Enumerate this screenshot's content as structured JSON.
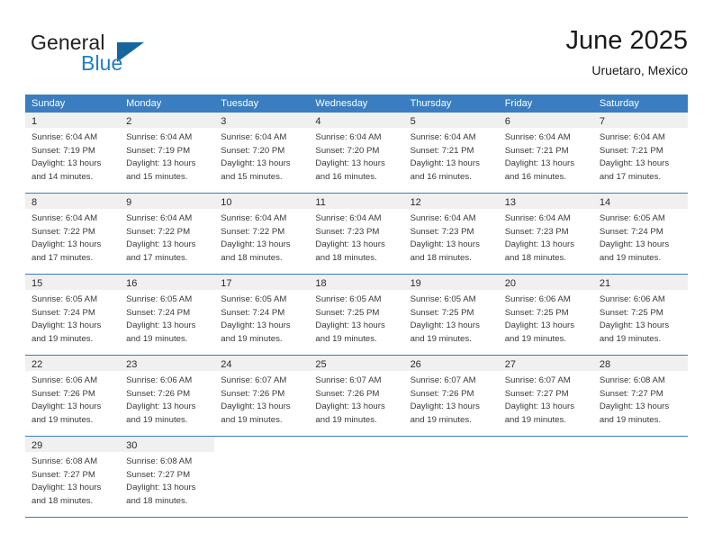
{
  "brand": {
    "line1": "General",
    "line2": "Blue",
    "triangle_icon": "brand-triangle-icon",
    "color_dark": "#231f20",
    "color_blue": "#1f7fc4",
    "color_triangle": "#15659f"
  },
  "header": {
    "title": "June 2025",
    "location": "Uruetaro, Mexico"
  },
  "colors": {
    "header_row_bg": "#3a7dc0",
    "daynum_band_bg": "#f0f0f0",
    "grid_line": "#3a7dc0",
    "text": "#3a3a3a"
  },
  "weekdays": [
    "Sunday",
    "Monday",
    "Tuesday",
    "Wednesday",
    "Thursday",
    "Friday",
    "Saturday"
  ],
  "weeks": [
    [
      {
        "day": "1",
        "sunrise": "Sunrise: 6:04 AM",
        "sunset": "Sunset: 7:19 PM",
        "daylight1": "Daylight: 13 hours",
        "daylight2": "and 14 minutes."
      },
      {
        "day": "2",
        "sunrise": "Sunrise: 6:04 AM",
        "sunset": "Sunset: 7:19 PM",
        "daylight1": "Daylight: 13 hours",
        "daylight2": "and 15 minutes."
      },
      {
        "day": "3",
        "sunrise": "Sunrise: 6:04 AM",
        "sunset": "Sunset: 7:20 PM",
        "daylight1": "Daylight: 13 hours",
        "daylight2": "and 15 minutes."
      },
      {
        "day": "4",
        "sunrise": "Sunrise: 6:04 AM",
        "sunset": "Sunset: 7:20 PM",
        "daylight1": "Daylight: 13 hours",
        "daylight2": "and 16 minutes."
      },
      {
        "day": "5",
        "sunrise": "Sunrise: 6:04 AM",
        "sunset": "Sunset: 7:21 PM",
        "daylight1": "Daylight: 13 hours",
        "daylight2": "and 16 minutes."
      },
      {
        "day": "6",
        "sunrise": "Sunrise: 6:04 AM",
        "sunset": "Sunset: 7:21 PM",
        "daylight1": "Daylight: 13 hours",
        "daylight2": "and 16 minutes."
      },
      {
        "day": "7",
        "sunrise": "Sunrise: 6:04 AM",
        "sunset": "Sunset: 7:21 PM",
        "daylight1": "Daylight: 13 hours",
        "daylight2": "and 17 minutes."
      }
    ],
    [
      {
        "day": "8",
        "sunrise": "Sunrise: 6:04 AM",
        "sunset": "Sunset: 7:22 PM",
        "daylight1": "Daylight: 13 hours",
        "daylight2": "and 17 minutes."
      },
      {
        "day": "9",
        "sunrise": "Sunrise: 6:04 AM",
        "sunset": "Sunset: 7:22 PM",
        "daylight1": "Daylight: 13 hours",
        "daylight2": "and 17 minutes."
      },
      {
        "day": "10",
        "sunrise": "Sunrise: 6:04 AM",
        "sunset": "Sunset: 7:22 PM",
        "daylight1": "Daylight: 13 hours",
        "daylight2": "and 18 minutes."
      },
      {
        "day": "11",
        "sunrise": "Sunrise: 6:04 AM",
        "sunset": "Sunset: 7:23 PM",
        "daylight1": "Daylight: 13 hours",
        "daylight2": "and 18 minutes."
      },
      {
        "day": "12",
        "sunrise": "Sunrise: 6:04 AM",
        "sunset": "Sunset: 7:23 PM",
        "daylight1": "Daylight: 13 hours",
        "daylight2": "and 18 minutes."
      },
      {
        "day": "13",
        "sunrise": "Sunrise: 6:04 AM",
        "sunset": "Sunset: 7:23 PM",
        "daylight1": "Daylight: 13 hours",
        "daylight2": "and 18 minutes."
      },
      {
        "day": "14",
        "sunrise": "Sunrise: 6:05 AM",
        "sunset": "Sunset: 7:24 PM",
        "daylight1": "Daylight: 13 hours",
        "daylight2": "and 19 minutes."
      }
    ],
    [
      {
        "day": "15",
        "sunrise": "Sunrise: 6:05 AM",
        "sunset": "Sunset: 7:24 PM",
        "daylight1": "Daylight: 13 hours",
        "daylight2": "and 19 minutes."
      },
      {
        "day": "16",
        "sunrise": "Sunrise: 6:05 AM",
        "sunset": "Sunset: 7:24 PM",
        "daylight1": "Daylight: 13 hours",
        "daylight2": "and 19 minutes."
      },
      {
        "day": "17",
        "sunrise": "Sunrise: 6:05 AM",
        "sunset": "Sunset: 7:24 PM",
        "daylight1": "Daylight: 13 hours",
        "daylight2": "and 19 minutes."
      },
      {
        "day": "18",
        "sunrise": "Sunrise: 6:05 AM",
        "sunset": "Sunset: 7:25 PM",
        "daylight1": "Daylight: 13 hours",
        "daylight2": "and 19 minutes."
      },
      {
        "day": "19",
        "sunrise": "Sunrise: 6:05 AM",
        "sunset": "Sunset: 7:25 PM",
        "daylight1": "Daylight: 13 hours",
        "daylight2": "and 19 minutes."
      },
      {
        "day": "20",
        "sunrise": "Sunrise: 6:06 AM",
        "sunset": "Sunset: 7:25 PM",
        "daylight1": "Daylight: 13 hours",
        "daylight2": "and 19 minutes."
      },
      {
        "day": "21",
        "sunrise": "Sunrise: 6:06 AM",
        "sunset": "Sunset: 7:25 PM",
        "daylight1": "Daylight: 13 hours",
        "daylight2": "and 19 minutes."
      }
    ],
    [
      {
        "day": "22",
        "sunrise": "Sunrise: 6:06 AM",
        "sunset": "Sunset: 7:26 PM",
        "daylight1": "Daylight: 13 hours",
        "daylight2": "and 19 minutes."
      },
      {
        "day": "23",
        "sunrise": "Sunrise: 6:06 AM",
        "sunset": "Sunset: 7:26 PM",
        "daylight1": "Daylight: 13 hours",
        "daylight2": "and 19 minutes."
      },
      {
        "day": "24",
        "sunrise": "Sunrise: 6:07 AM",
        "sunset": "Sunset: 7:26 PM",
        "daylight1": "Daylight: 13 hours",
        "daylight2": "and 19 minutes."
      },
      {
        "day": "25",
        "sunrise": "Sunrise: 6:07 AM",
        "sunset": "Sunset: 7:26 PM",
        "daylight1": "Daylight: 13 hours",
        "daylight2": "and 19 minutes."
      },
      {
        "day": "26",
        "sunrise": "Sunrise: 6:07 AM",
        "sunset": "Sunset: 7:26 PM",
        "daylight1": "Daylight: 13 hours",
        "daylight2": "and 19 minutes."
      },
      {
        "day": "27",
        "sunrise": "Sunrise: 6:07 AM",
        "sunset": "Sunset: 7:27 PM",
        "daylight1": "Daylight: 13 hours",
        "daylight2": "and 19 minutes."
      },
      {
        "day": "28",
        "sunrise": "Sunrise: 6:08 AM",
        "sunset": "Sunset: 7:27 PM",
        "daylight1": "Daylight: 13 hours",
        "daylight2": "and 19 minutes."
      }
    ],
    [
      {
        "day": "29",
        "sunrise": "Sunrise: 6:08 AM",
        "sunset": "Sunset: 7:27 PM",
        "daylight1": "Daylight: 13 hours",
        "daylight2": "and 18 minutes."
      },
      {
        "day": "30",
        "sunrise": "Sunrise: 6:08 AM",
        "sunset": "Sunset: 7:27 PM",
        "daylight1": "Daylight: 13 hours",
        "daylight2": "and 18 minutes."
      },
      {
        "day": "",
        "sunrise": "",
        "sunset": "",
        "daylight1": "",
        "daylight2": ""
      },
      {
        "day": "",
        "sunrise": "",
        "sunset": "",
        "daylight1": "",
        "daylight2": ""
      },
      {
        "day": "",
        "sunrise": "",
        "sunset": "",
        "daylight1": "",
        "daylight2": ""
      },
      {
        "day": "",
        "sunrise": "",
        "sunset": "",
        "daylight1": "",
        "daylight2": ""
      },
      {
        "day": "",
        "sunrise": "",
        "sunset": "",
        "daylight1": "",
        "daylight2": ""
      }
    ]
  ]
}
